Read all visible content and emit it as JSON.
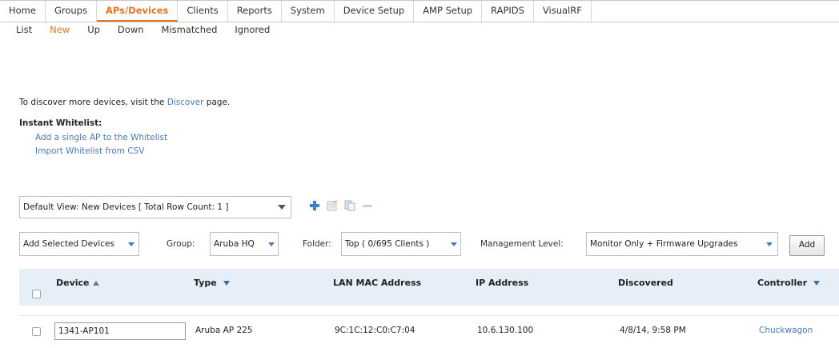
{
  "nav": {
    "tabs": [
      {
        "label": "Home"
      },
      {
        "label": "Groups"
      },
      {
        "label": "APs/Devices"
      },
      {
        "label": "Clients"
      },
      {
        "label": "Reports"
      },
      {
        "label": "System"
      },
      {
        "label": "Device Setup"
      },
      {
        "label": "AMP Setup"
      },
      {
        "label": "RAPIDS"
      },
      {
        "label": "VisualRF"
      }
    ],
    "active_tab": "APs/Devices",
    "subtabs": [
      {
        "label": "List"
      },
      {
        "label": "New"
      },
      {
        "label": "Up"
      },
      {
        "label": "Down"
      },
      {
        "label": "Mismatched"
      },
      {
        "label": "Ignored"
      }
    ],
    "active_subtab": "New"
  },
  "discover": {
    "prefix": "To discover more devices, visit the ",
    "link": "Discover",
    "suffix": " page."
  },
  "whitelist": {
    "title": "Instant Whitelist:",
    "links": [
      "Add a single AP to the Whitelist",
      "Import Whitelist from CSV"
    ]
  },
  "view": {
    "label": "Default View: New Devices   [ Total Row Count: 1 ]",
    "icons": [
      "add-icon",
      "edit-icon",
      "copy-icon",
      "delete-icon"
    ]
  },
  "toolbar": {
    "action": "Add Selected Devices",
    "group_label": "Group:",
    "group_value": "Aruba HQ",
    "folder_label": "Folder:",
    "folder_value": "Top ( 0/695 Clients )",
    "mgmt_label": "Management Level:",
    "mgmt_value": "Monitor Only + Firmware Upgrades",
    "add_label": "Add"
  },
  "table": {
    "columns": [
      "Device",
      "Type",
      "LAN MAC Address",
      "IP Address",
      "Discovered",
      "Controller"
    ],
    "rows": [
      {
        "device": "1341-AP101",
        "type": "Aruba AP 225",
        "mac": "9C:1C:12:C0:C7:04",
        "ip": "10.6.130.100",
        "discovered": "4/8/14, 9:58 PM",
        "controller": "Chuckwagon"
      }
    ]
  },
  "colors": {
    "accent": "#e8731a",
    "link": "#4a7ab5",
    "header_bg": "#e6eef8"
  }
}
